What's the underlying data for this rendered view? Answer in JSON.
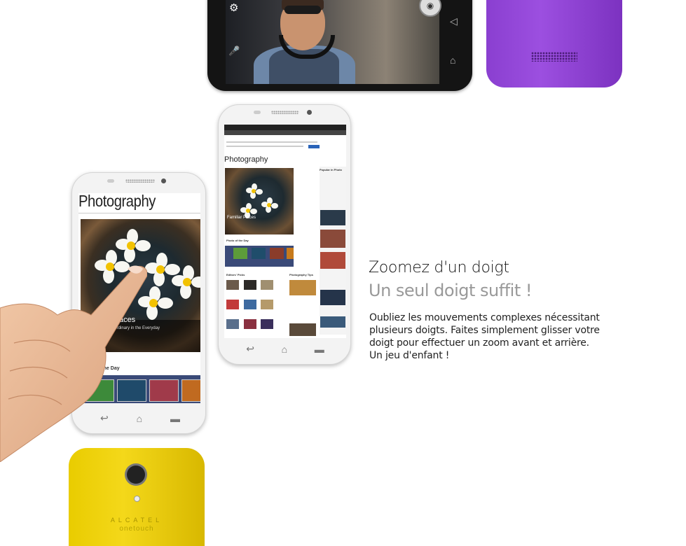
{
  "top_phone": {
    "icons": [
      "settings-gear-icon",
      "camera-shutter-icon",
      "mic-off-icon",
      "back-icon",
      "home-icon"
    ]
  },
  "left_phone": {
    "title": "Photography",
    "caption": "Familiar Places",
    "subcaption": "Finding the Extraordinary in the Everyday",
    "section": "Photo of the Day"
  },
  "middle_phone": {
    "title": "Photography",
    "caption": "Familiar Places",
    "section_potd": "Photo of the Day",
    "section_editors": "Editors' Picks",
    "section_tips": "Photography Tips",
    "section_popular": "Popular in Photo"
  },
  "yellow_phone": {
    "brand": "ALCATEL",
    "model": "onetouch"
  },
  "feature": {
    "headline": "Zoomez d'un doigt",
    "subhead": "Un seul doigt suffit !",
    "body": [
      "Oubliez les mouvements complexes nécessitant",
      "plusieurs doigts. Faites simplement glisser votre",
      "doigt pour effectuer un zoom avant et arrière.",
      "Un jeu d'enfant !"
    ]
  },
  "colors": {
    "purple_phone": "#8a3fd0",
    "yellow_phone": "#f4d81a",
    "headline": "#111111",
    "subhead": "#999999"
  }
}
